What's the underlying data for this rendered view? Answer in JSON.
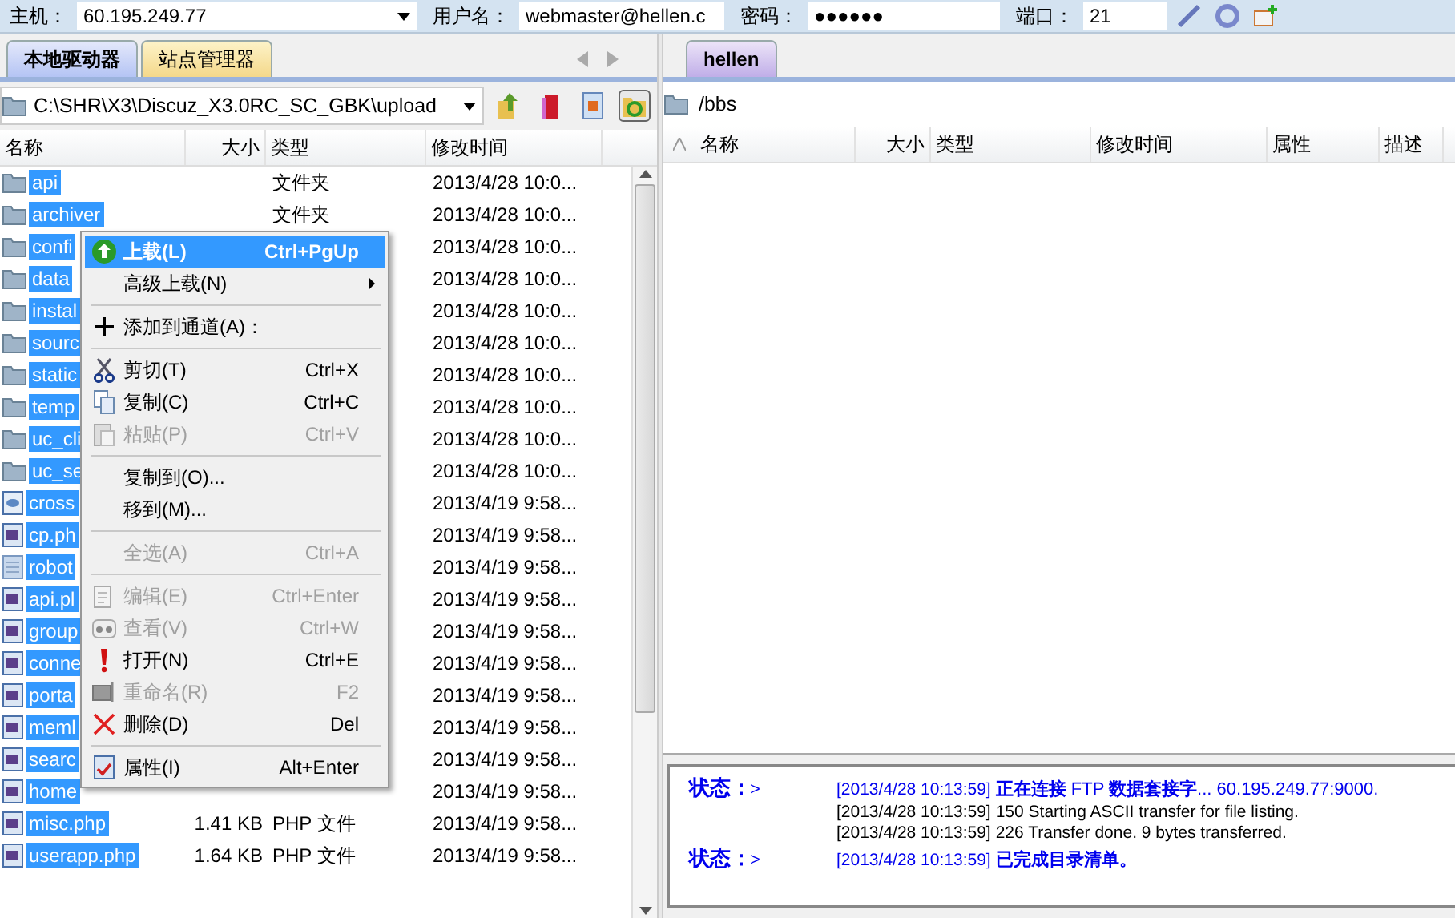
{
  "connection": {
    "host_label": "主机：",
    "host": "60.195.249.77",
    "user_label": "用户名：",
    "user": "webmaster@hellen.c",
    "password_label": "密码：",
    "password": "●●●●●●",
    "port_label": "端口：",
    "port": "21"
  },
  "local": {
    "tabs": [
      {
        "label": "本地驱动器",
        "selected": true
      },
      {
        "label": "站点管理器",
        "selected": false
      }
    ],
    "path": "C:\\SHR\\X3\\Discuz_X3.0RC_SC_GBK\\upload",
    "columns": [
      "名称",
      "大小",
      "类型",
      "修改时间"
    ],
    "rows": [
      {
        "kind": "folder",
        "name": "api",
        "type": "文件夹",
        "modified": "2013/4/28 10:0...",
        "selected": true
      },
      {
        "kind": "folder",
        "name": "archiver",
        "type": "文件夹",
        "modified": "2013/4/28 10:0...",
        "selected": true
      },
      {
        "kind": "folder",
        "name": "confi",
        "modified": "2013/4/28 10:0...",
        "selected": true
      },
      {
        "kind": "folder",
        "name": "data",
        "modified": "2013/4/28 10:0...",
        "selected": true
      },
      {
        "kind": "folder",
        "name": "instal",
        "modified": "2013/4/28 10:0...",
        "selected": true
      },
      {
        "kind": "folder",
        "name": "sourc",
        "modified": "2013/4/28 10:0...",
        "selected": true
      },
      {
        "kind": "folder",
        "name": "static",
        "modified": "2013/4/28 10:0...",
        "selected": true
      },
      {
        "kind": "folder",
        "name": "temp",
        "modified": "2013/4/28 10:0...",
        "selected": true
      },
      {
        "kind": "folder",
        "name": "uc_cli",
        "modified": "2013/4/28 10:0...",
        "selected": true
      },
      {
        "kind": "folder",
        "name": "uc_se",
        "modified": "2013/4/28 10:0...",
        "selected": true
      },
      {
        "kind": "xml",
        "name": "cross",
        "modified": "2013/4/19 9:58...",
        "selected": true
      },
      {
        "kind": "php",
        "name": "cp.ph",
        "modified": "2013/4/19 9:58...",
        "selected": true
      },
      {
        "kind": "text",
        "name": "robot",
        "modified": "2013/4/19 9:58...",
        "selected": true
      },
      {
        "kind": "php",
        "name": "api.pl",
        "modified": "2013/4/19 9:58...",
        "selected": true
      },
      {
        "kind": "php",
        "name": "group",
        "modified": "2013/4/19 9:58...",
        "selected": true
      },
      {
        "kind": "php",
        "name": "conne",
        "modified": "2013/4/19 9:58...",
        "selected": true
      },
      {
        "kind": "php",
        "name": "porta",
        "modified": "2013/4/19 9:58...",
        "selected": true
      },
      {
        "kind": "php",
        "name": "meml",
        "modified": "2013/4/19 9:58...",
        "selected": true
      },
      {
        "kind": "php",
        "name": "searc",
        "modified": "2013/4/19 9:58...",
        "selected": true
      },
      {
        "kind": "php",
        "name": "home",
        "modified": "2013/4/19 9:58...",
        "selected": true
      },
      {
        "kind": "php",
        "name": "misc.php",
        "size": "1.41 KB",
        "type": "PHP 文件",
        "modified": "2013/4/19 9:58...",
        "selected": true
      },
      {
        "kind": "php",
        "name": "userapp.php",
        "size": "1.64 KB",
        "type": "PHP 文件",
        "modified": "2013/4/19 9:58...",
        "selected": true
      }
    ]
  },
  "context_menu": [
    {
      "kind": "item",
      "label": "上载(L)",
      "shortcut": "Ctrl+PgUp",
      "selected": true,
      "disabled": false,
      "submenu": false
    },
    {
      "kind": "item",
      "label": "高级上载(N)",
      "selected": false,
      "disabled": false,
      "submenu": true
    },
    {
      "kind": "separator"
    },
    {
      "kind": "item",
      "label": "添加到通道(A)：",
      "selected": false,
      "disabled": false,
      "submenu": false
    },
    {
      "kind": "separator"
    },
    {
      "kind": "item",
      "label": "剪切(T)",
      "shortcut": "Ctrl+X",
      "selected": false,
      "disabled": false,
      "submenu": false
    },
    {
      "kind": "item",
      "label": "复制(C)",
      "shortcut": "Ctrl+C",
      "selected": false,
      "disabled": false,
      "submenu": false
    },
    {
      "kind": "item",
      "label": "粘贴(P)",
      "shortcut": "Ctrl+V",
      "selected": false,
      "disabled": true,
      "submenu": false
    },
    {
      "kind": "separator"
    },
    {
      "kind": "item",
      "label": "复制到(O)...",
      "selected": false,
      "disabled": false,
      "submenu": false
    },
    {
      "kind": "item",
      "label": "移到(M)...",
      "selected": false,
      "disabled": false,
      "submenu": false
    },
    {
      "kind": "separator"
    },
    {
      "kind": "item",
      "label": "全选(A)",
      "shortcut": "Ctrl+A",
      "selected": false,
      "disabled": true,
      "submenu": false
    },
    {
      "kind": "separator"
    },
    {
      "kind": "item",
      "label": "编辑(E)",
      "shortcut": "Ctrl+Enter",
      "selected": false,
      "disabled": true,
      "submenu": false
    },
    {
      "kind": "item",
      "label": "查看(V)",
      "shortcut": "Ctrl+W",
      "selected": false,
      "disabled": true,
      "submenu": false
    },
    {
      "kind": "item",
      "label": "打开(N)",
      "shortcut": "Ctrl+E",
      "selected": false,
      "disabled": false,
      "submenu": false
    },
    {
      "kind": "item",
      "label": "重命名(R)",
      "shortcut": "F2",
      "selected": false,
      "disabled": true,
      "submenu": false
    },
    {
      "kind": "item",
      "label": "删除(D)",
      "shortcut": "Del",
      "selected": false,
      "disabled": false,
      "submenu": false
    },
    {
      "kind": "separator"
    },
    {
      "kind": "item",
      "label": "属性(I)",
      "shortcut": "Alt+Enter",
      "selected": false,
      "disabled": false,
      "submenu": false
    }
  ],
  "remote": {
    "tabs": [
      {
        "label": "hellen",
        "selected": true
      }
    ],
    "path": "/bbs",
    "columns": [
      "名称",
      "大小",
      "类型",
      "修改时间",
      "属性",
      "描述"
    ]
  },
  "log": [
    {
      "kind": "status",
      "label": "状态：",
      "prompt": ">",
      "time": "[2013/4/28 10:13:59]",
      "message": "**正在连接** FTP **数据套接字**... 60.195.249.77:9000."
    },
    {
      "kind": "response",
      "time": "[2013/4/28 10:13:59]",
      "message": "150 Starting ASCII transfer for file listing."
    },
    {
      "kind": "response",
      "time": "[2013/4/28 10:13:59]",
      "message": "226 Transfer done. 9 bytes transferred."
    },
    {
      "kind": "status",
      "label": "状态：",
      "prompt": ">",
      "time": "[2013/4/28 10:13:59]",
      "message": "**已完成目录清单。**"
    }
  ]
}
